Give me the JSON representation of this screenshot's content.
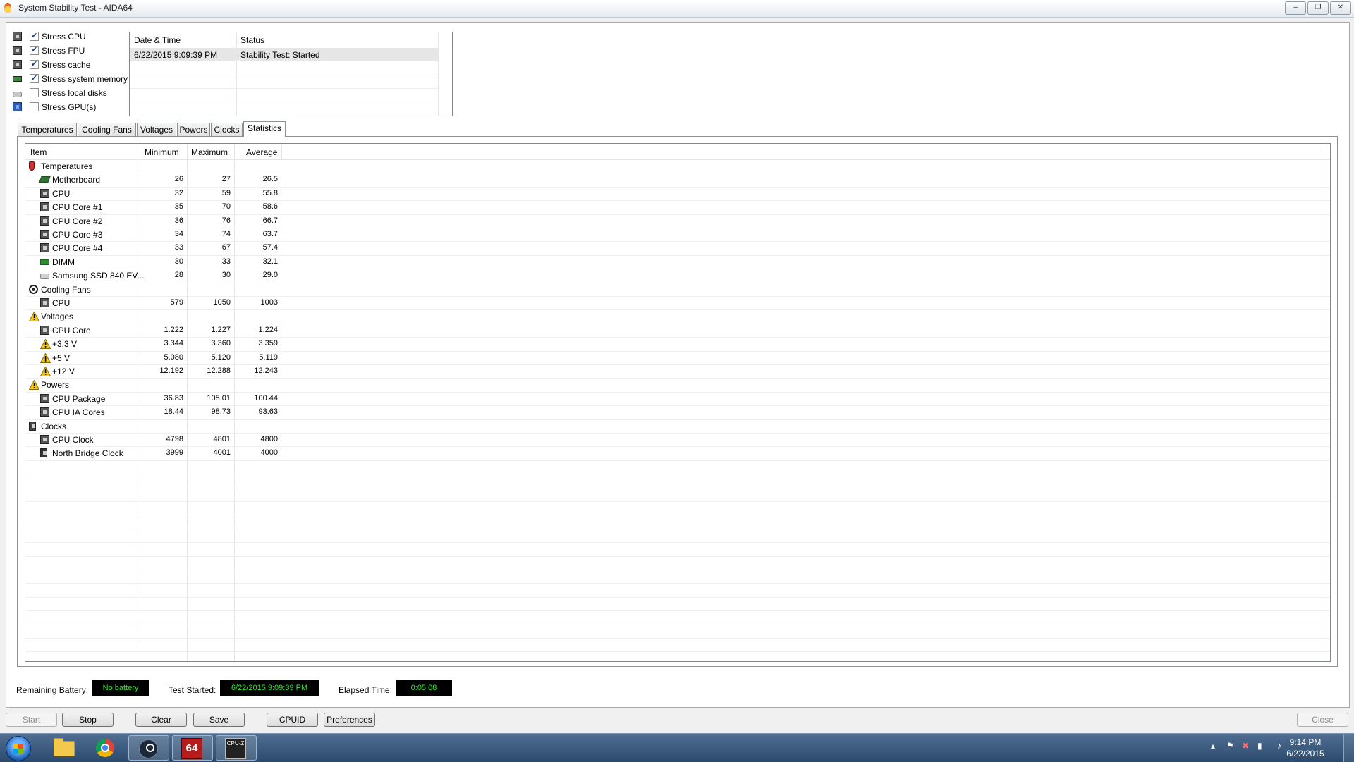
{
  "window": {
    "title": "System Stability Test - AIDA64",
    "controls": {
      "minimize": "–",
      "restore": "❐",
      "close": "✕"
    }
  },
  "stress_options": [
    {
      "label": "Stress CPU",
      "checked": true,
      "icon": "cpu-icon"
    },
    {
      "label": "Stress FPU",
      "checked": true,
      "icon": "fpu-icon"
    },
    {
      "label": "Stress cache",
      "checked": true,
      "icon": "cache-icon"
    },
    {
      "label": "Stress system memory",
      "checked": true,
      "icon": "memory-icon"
    },
    {
      "label": "Stress local disks",
      "checked": false,
      "icon": "disk-icon"
    },
    {
      "label": "Stress GPU(s)",
      "checked": false,
      "icon": "gpu-icon"
    }
  ],
  "log": {
    "columns": [
      "Date & Time",
      "Status"
    ],
    "rows": [
      {
        "datetime": "6/22/2015 9:09:39 PM",
        "status": "Stability Test: Started"
      }
    ]
  },
  "tabs": [
    "Temperatures",
    "Cooling Fans",
    "Voltages",
    "Powers",
    "Clocks",
    "Statistics"
  ],
  "active_tab": "Statistics",
  "stats": {
    "columns": [
      "Item",
      "Minimum",
      "Maximum",
      "Average"
    ],
    "rows": [
      {
        "type": "group",
        "label": "Temperatures",
        "icon": "thermometer-icon"
      },
      {
        "type": "item",
        "label": "Motherboard",
        "icon": "motherboard-icon",
        "min": "26",
        "max": "27",
        "avg": "26.5"
      },
      {
        "type": "item",
        "label": "CPU",
        "icon": "cpu-icon",
        "min": "32",
        "max": "59",
        "avg": "55.8"
      },
      {
        "type": "item",
        "label": "CPU Core #1",
        "icon": "cpu-icon",
        "min": "35",
        "max": "70",
        "avg": "58.6"
      },
      {
        "type": "item",
        "label": "CPU Core #2",
        "icon": "cpu-icon",
        "min": "36",
        "max": "76",
        "avg": "66.7"
      },
      {
        "type": "item",
        "label": "CPU Core #3",
        "icon": "cpu-icon",
        "min": "34",
        "max": "74",
        "avg": "63.7"
      },
      {
        "type": "item",
        "label": "CPU Core #4",
        "icon": "cpu-icon",
        "min": "33",
        "max": "67",
        "avg": "57.4"
      },
      {
        "type": "item",
        "label": "DIMM",
        "icon": "dimm-icon",
        "min": "30",
        "max": "33",
        "avg": "32.1"
      },
      {
        "type": "item",
        "label": "Samsung SSD 840 EV...",
        "icon": "ssd-icon",
        "min": "28",
        "max": "30",
        "avg": "29.0"
      },
      {
        "type": "group",
        "label": "Cooling Fans",
        "icon": "fan-icon"
      },
      {
        "type": "item",
        "label": "CPU",
        "icon": "cpu-icon",
        "min": "579",
        "max": "1050",
        "avg": "1003"
      },
      {
        "type": "group",
        "label": "Voltages",
        "icon": "warning-icon"
      },
      {
        "type": "item",
        "label": "CPU Core",
        "icon": "cpu-icon",
        "min": "1.222",
        "max": "1.227",
        "avg": "1.224"
      },
      {
        "type": "item",
        "label": "+3.3 V",
        "icon": "warning-icon",
        "min": "3.344",
        "max": "3.360",
        "avg": "3.359"
      },
      {
        "type": "item",
        "label": "+5 V",
        "icon": "warning-icon",
        "min": "5.080",
        "max": "5.120",
        "avg": "5.119"
      },
      {
        "type": "item",
        "label": "+12 V",
        "icon": "warning-icon",
        "min": "12.192",
        "max": "12.288",
        "avg": "12.243"
      },
      {
        "type": "group",
        "label": "Powers",
        "icon": "warning-icon"
      },
      {
        "type": "item",
        "label": "CPU Package",
        "icon": "cpu-icon",
        "min": "36.83",
        "max": "105.01",
        "avg": "100.44"
      },
      {
        "type": "item",
        "label": "CPU IA Cores",
        "icon": "cpu-icon",
        "min": "18.44",
        "max": "98.73",
        "avg": "93.63"
      },
      {
        "type": "group",
        "label": "Clocks",
        "icon": "clock-chip-icon"
      },
      {
        "type": "item",
        "label": "CPU Clock",
        "icon": "cpu-icon",
        "min": "4798",
        "max": "4801",
        "avg": "4800"
      },
      {
        "type": "item",
        "label": "North Bridge Clock",
        "icon": "northbridge-icon",
        "min": "3999",
        "max": "4001",
        "avg": "4000"
      }
    ]
  },
  "info": {
    "remaining_battery_label": "Remaining Battery:",
    "remaining_battery_value": "No battery",
    "test_started_label": "Test Started:",
    "test_started_value": "6/22/2015 9:09:39 PM",
    "elapsed_label": "Elapsed Time:",
    "elapsed_value": "0:05:08"
  },
  "buttons": {
    "start": "Start",
    "stop": "Stop",
    "clear": "Clear",
    "save": "Save",
    "cpuid": "CPUID",
    "preferences": "Preferences",
    "close": "Close"
  },
  "taskbar": {
    "apps": [
      "windows-explorer",
      "google-chrome",
      "steam",
      "aida64",
      "cpu-z"
    ],
    "aida_label": "64",
    "cpuz_label": "CPU-Z",
    "time": "9:14 PM",
    "date": "6/22/2015"
  },
  "colors": {
    "info_box_bg": "#000000",
    "info_box_text": "#2eea2e",
    "taskbar": "#3a5a80"
  }
}
